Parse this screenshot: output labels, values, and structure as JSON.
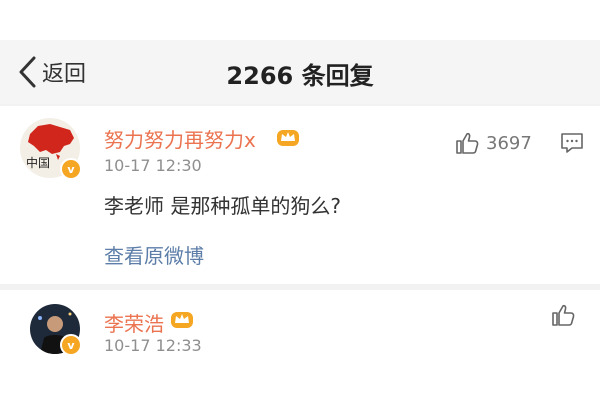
{
  "header": {
    "back_label": "返回",
    "title": "2266 条回复"
  },
  "comments": [
    {
      "username": "努力努力再努力x",
      "time": "10-17 12:30",
      "text": "李老师 是那种孤单的狗么?",
      "like_count": "3697",
      "view_original": "查看原微博",
      "avatar_text": "中国"
    },
    {
      "username": "李荣浩",
      "time": "10-17 12:33",
      "text": "",
      "like_count": ""
    }
  ],
  "colors": {
    "username": "#eb7350",
    "link": "#5c7ea8",
    "badge": "#f5a623"
  },
  "icons": [
    "chevron-left-icon",
    "crown-icon",
    "thumbs-up-icon",
    "comment-icon",
    "verified-icon"
  ]
}
